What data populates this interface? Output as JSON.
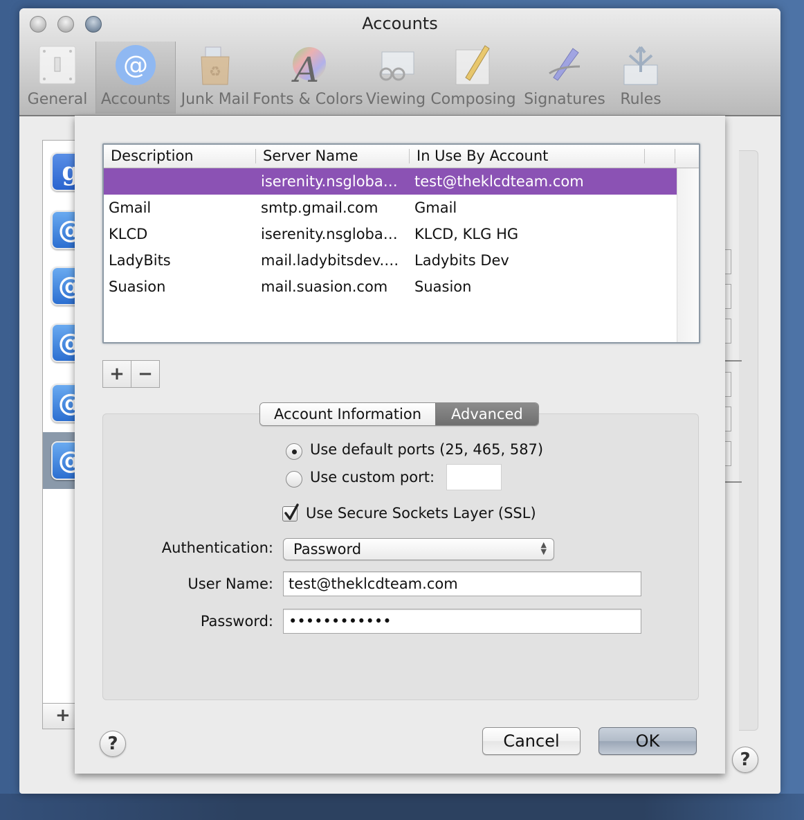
{
  "window": {
    "title": "Accounts"
  },
  "toolbar": {
    "items": [
      {
        "label": "General",
        "icon": "light-switch-icon",
        "selected": false
      },
      {
        "label": "Accounts",
        "icon": "at-sign-icon",
        "selected": true
      },
      {
        "label": "Junk Mail",
        "icon": "recycle-bag-icon",
        "selected": false
      },
      {
        "label": "Fonts & Colors",
        "icon": "font-color-wheel-icon",
        "selected": false
      },
      {
        "label": "Viewing",
        "icon": "glasses-envelope-icon",
        "selected": false
      },
      {
        "label": "Composing",
        "icon": "pencil-paper-icon",
        "selected": false
      },
      {
        "label": "Signatures",
        "icon": "pen-icon",
        "selected": false
      },
      {
        "label": "Rules",
        "icon": "rules-arrows-icon",
        "selected": false
      }
    ]
  },
  "background_accounts": {
    "icons": [
      "google-icon",
      "at-sign-icon",
      "at-sign-icon",
      "at-sign-icon",
      "at-sign-icon",
      "at-sign-icon"
    ],
    "add_label": "+",
    "help_label": "?"
  },
  "smtp_sheet": {
    "table": {
      "columns": [
        "Description",
        "Server Name",
        "In Use By Account"
      ],
      "rows": [
        {
          "description": "",
          "server": "iserenity.nsgloba…",
          "account": "test@theklcdteam.com",
          "selected": true
        },
        {
          "description": "Gmail",
          "server": "smtp.gmail.com",
          "account": "Gmail",
          "selected": false
        },
        {
          "description": "KLCD",
          "server": "iserenity.nsgloba…",
          "account": "KLCD, KLG HG",
          "selected": false
        },
        {
          "description": "LadyBits",
          "server": "mail.ladybitsdev.…",
          "account": "Ladybits Dev",
          "selected": false
        },
        {
          "description": "Suasion",
          "server": "mail.suasion.com",
          "account": "Suasion",
          "selected": false
        }
      ],
      "selection_color": "#8b52b4"
    },
    "add_button": "+",
    "remove_button": "−",
    "tabs": [
      {
        "label": "Account Information",
        "active": false
      },
      {
        "label": "Advanced",
        "active": true
      }
    ],
    "advanced": {
      "port_options": [
        {
          "label": "Use default ports (25, 465, 587)",
          "selected": true
        },
        {
          "label": "Use custom port:",
          "selected": false
        }
      ],
      "custom_port_value": "",
      "ssl_label": "Use Secure Sockets Layer (SSL)",
      "ssl_checked": true,
      "authentication_label": "Authentication:",
      "authentication_value": "Password",
      "username_label": "User Name:",
      "username_value": "test@theklcdteam.com",
      "password_label": "Password:",
      "password_value": "••••••••••••"
    },
    "help_label": "?",
    "cancel_label": "Cancel",
    "ok_label": "OK"
  }
}
